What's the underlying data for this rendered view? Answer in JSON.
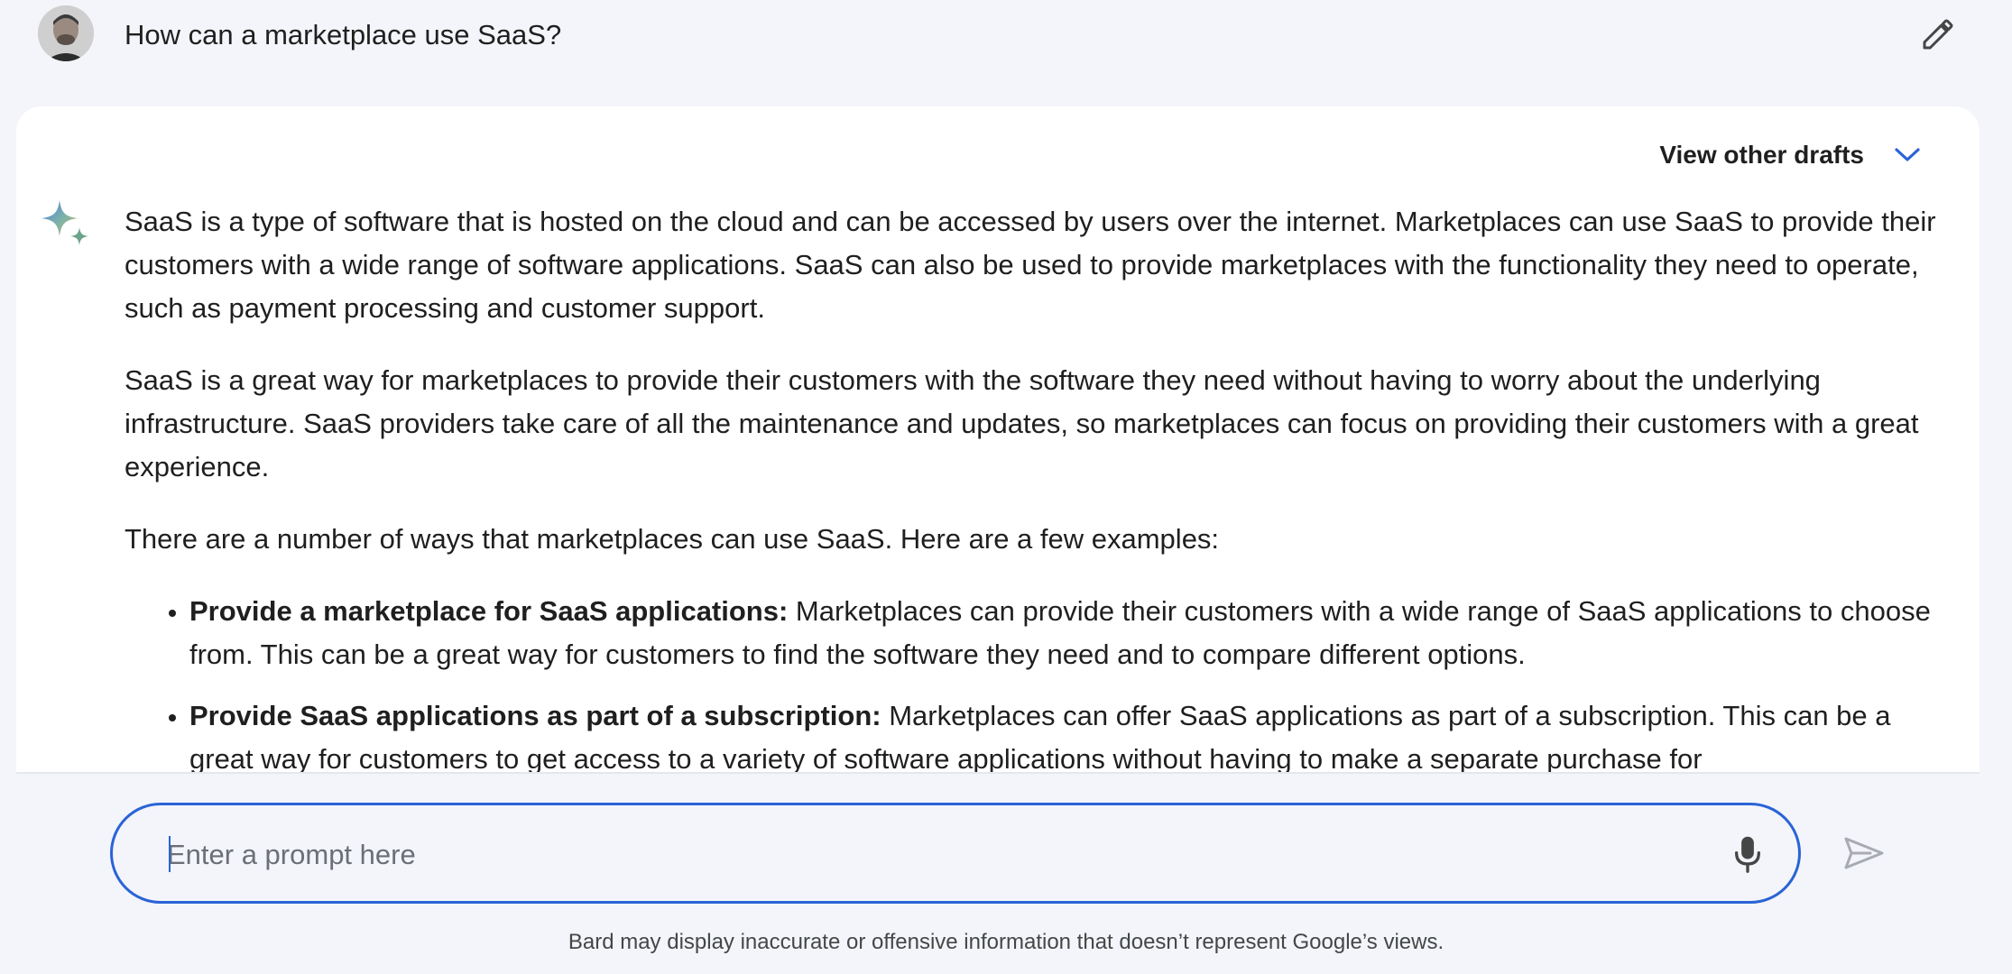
{
  "query": {
    "text": "How can a marketplace use SaaS?"
  },
  "response": {
    "drafts_label": "View other drafts",
    "paragraphs": [
      "SaaS is a type of software that is hosted on the cloud and can be accessed by users over the internet. Marketplaces can use SaaS to provide their customers with a wide range of software applications. SaaS can also be used to provide marketplaces with the functionality they need to operate, such as payment processing and customer support.",
      "SaaS is a great way for marketplaces to provide their customers with the software they need without having to worry about the underlying infrastructure. SaaS providers take care of all the maintenance and updates, so marketplaces can focus on providing their customers with a great experience.",
      "There are a number of ways that marketplaces can use SaaS. Here are a few examples:"
    ],
    "bullets": [
      {
        "lead": "Provide a marketplace for SaaS applications:",
        "text": " Marketplaces can provide their customers with a wide range of SaaS applications to choose from. This can be a great way for customers to find the software they need and to compare different options."
      },
      {
        "lead": "Provide SaaS applications as part of a subscription:",
        "text": " Marketplaces can offer SaaS applications as part of a subscription. This can be a great way for customers to get access to a variety of software applications without having to make a separate purchase for"
      }
    ]
  },
  "prompt": {
    "placeholder": "Enter a prompt here",
    "value": ""
  },
  "footer": {
    "disclaimer": "Bard may display inaccurate or offensive information that doesn’t represent Google’s views."
  },
  "icons": {
    "avatar": "user-avatar",
    "edit": "pencil-icon",
    "drafts_toggle": "chevron-down-icon",
    "assistant": "sparkle-icon",
    "mic": "microphone-icon",
    "send": "send-icon"
  },
  "colors": {
    "accent": "#2a63d6",
    "background": "#f3f5fa",
    "card": "#ffffff",
    "text": "#1f1f1f",
    "muted": "#6b6f76"
  }
}
